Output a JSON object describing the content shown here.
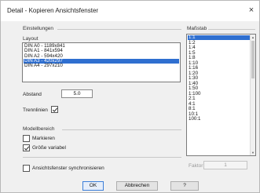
{
  "dialog": {
    "title": "Detail - Kopieren Ansichtsfenster",
    "close_symbol": "×"
  },
  "einstellungen": {
    "heading": "Einstellungen",
    "layout_label": "Layout",
    "layout_items": [
      {
        "label": "DIN A0 - 1189x841",
        "selected": false
      },
      {
        "label": "DIN A1 - 841x594",
        "selected": false
      },
      {
        "label": "DIN A2 - 594x420",
        "selected": false
      },
      {
        "label": "DIN A3 - 420x297",
        "selected": true
      },
      {
        "label": "DIN A4 - 297x210",
        "selected": false
      }
    ],
    "abstand_label": "Abstand",
    "abstand_value": "5.0",
    "trennlinien_label": "Trennlinien",
    "trennlinien_checked": true
  },
  "modellbereich": {
    "heading": "Modellbereich",
    "markieren_label": "Markieren",
    "markieren_checked": false,
    "groesse_label": "Größe variabel",
    "groesse_checked": true
  },
  "sync": {
    "label": "Ansichtsfenster synchronisieren",
    "checked": false
  },
  "massstab": {
    "heading": "Maßstab",
    "items": [
      "1:1",
      "1:2",
      "1:4",
      "1:5",
      "1:8",
      "1:10",
      "1:16",
      "1:20",
      "1:30",
      "1:40",
      "1:50",
      "1:100",
      "2:1",
      "4:1",
      "8:1",
      "10:1",
      "100:1"
    ],
    "selected_index": 0,
    "faktor_label": "Faktor",
    "faktor_value": "1"
  },
  "buttons": {
    "ok": "OK",
    "cancel": "Abbrechen",
    "help": "?"
  },
  "colors": {
    "selection": "#2f6fd0",
    "default_button_border": "#3c7fd9"
  }
}
